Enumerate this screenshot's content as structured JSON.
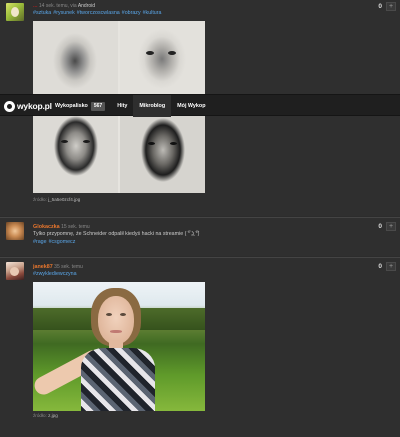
{
  "topbar": {
    "logo_text": "wykop.pl",
    "nav": [
      {
        "label": "Wykopalisko",
        "badge": "567"
      },
      {
        "label": "Hity"
      },
      {
        "label": "Mikroblog"
      },
      {
        "label": "Mój Wykop"
      }
    ]
  },
  "entries": [
    {
      "author": "...",
      "author_color": "#b51f1f",
      "meta": "14 sek. temu, via",
      "via": "Android",
      "tags": [
        "#sztuka",
        "#rysunek",
        "#tworczoscwlasna",
        "#obrazy",
        "#kultura"
      ],
      "votes": "0",
      "plus": "+",
      "source_label": "źródło:",
      "source_file": "j_5a5e0zcf4.jpg"
    },
    {
      "author": "Glokaczka",
      "author_color": "#e8762d",
      "meta": "15 sek. temu",
      "text": "Tylko przypomnę, że Schneider odpalił kiedyś hacki na streamie ( ͡° ͜ʖ ͡°)",
      "tags": [
        "#rage",
        "#csgomecz"
      ],
      "votes": "0",
      "plus": "+"
    },
    {
      "author": "janek87",
      "author_color": "#e8762d",
      "meta": "35 sek. temu",
      "tags": [
        "#zwyklediewczyna"
      ],
      "votes": "0",
      "plus": "+",
      "source_label": "źródło:",
      "source_file": "z.jpg"
    }
  ]
}
